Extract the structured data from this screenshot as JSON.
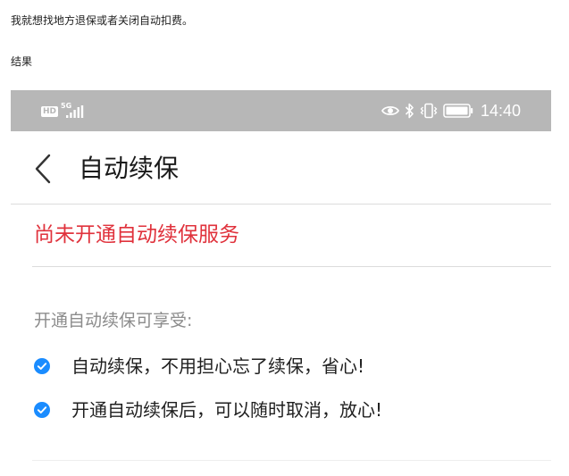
{
  "post": {
    "line1": "我就想找地方退保或者关闭自动扣费。",
    "line2": "结果"
  },
  "status_bar": {
    "hd_label": "HD",
    "network_label": "5G",
    "time": "14:40"
  },
  "nav": {
    "title": "自动续保"
  },
  "status_message": "尚未开通自动续保服务",
  "benefits": {
    "heading": "开通自动续保可享受:",
    "items": [
      {
        "text": "自动续保，不用担心忘了续保，省心!"
      },
      {
        "text": "开通自动续保后，可以随时取消，放心!"
      }
    ]
  },
  "colors": {
    "status_bar_bg": "#b7b7b7",
    "alert_red": "#e0323c",
    "check_blue": "#1a8cff",
    "divider": "#dcdcdc"
  }
}
